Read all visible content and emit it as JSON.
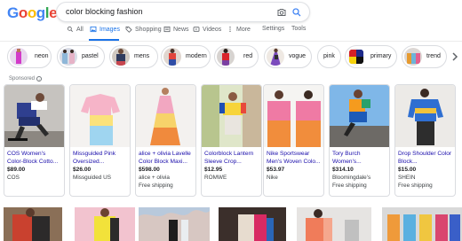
{
  "logo": {
    "letters": [
      "G",
      "o",
      "o",
      "g",
      "l",
      "e"
    ],
    "colors": [
      "#4285f4",
      "#ea4335",
      "#fbbc05",
      "#4285f4",
      "#34a853",
      "#ea4335"
    ]
  },
  "search": {
    "query": "color blocking fashion",
    "camera_icon": "camera-icon",
    "search_icon": "search-icon"
  },
  "tabs": [
    {
      "label": "All",
      "icon": "search-icon",
      "active": false
    },
    {
      "label": "Images",
      "icon": "image-icon",
      "active": true
    },
    {
      "label": "Shopping",
      "icon": "tag-icon",
      "active": false
    },
    {
      "label": "News",
      "icon": "news-icon",
      "active": false
    },
    {
      "label": "Videos",
      "icon": "play-icon",
      "active": false
    },
    {
      "label": "More",
      "icon": "more-icon",
      "active": false
    },
    {
      "label": "Settings",
      "active": false
    },
    {
      "label": "Tools",
      "active": false
    }
  ],
  "chips": [
    {
      "label": "neon"
    },
    {
      "label": "pastel"
    },
    {
      "label": "mens"
    },
    {
      "label": "modern"
    },
    {
      "label": "red"
    },
    {
      "label": "vogue"
    },
    {
      "label": "pink"
    },
    {
      "label": "primary"
    },
    {
      "label": "trend"
    }
  ],
  "sponsored_label": "Sponsored",
  "products": [
    {
      "title": "COS Women's Color-Block Cotto...",
      "price": "$89.00",
      "seller": "COS",
      "shipping": ""
    },
    {
      "title": "Missguided Pink Oversized...",
      "price": "$26.00",
      "seller": "Missguided US",
      "shipping": ""
    },
    {
      "title": "alice + olivia Lavelle Color Block Maxi...",
      "price": "$598.00",
      "seller": "alice + olivia",
      "shipping": "Free shipping"
    },
    {
      "title": "Colorblock Lantern Sleeve Crop...",
      "price": "$12.95",
      "seller": "ROMWE",
      "shipping": ""
    },
    {
      "title": "Nike Sportswear Men's Woven Colo...",
      "price": "$53.97",
      "seller": "Nike",
      "shipping": ""
    },
    {
      "title": "Tory Burch Women's...",
      "price": "$314.10",
      "seller": "Bloomingdale's",
      "shipping": "Free shipping"
    },
    {
      "title": "Drop Shoulder Color Block...",
      "price": "$15.00",
      "seller": "SHEIN",
      "shipping": "Free shipping"
    }
  ],
  "colors": {
    "accent": "#1a73e8",
    "link": "#1a0dab",
    "border": "#dadce0",
    "muted": "#70757a"
  }
}
